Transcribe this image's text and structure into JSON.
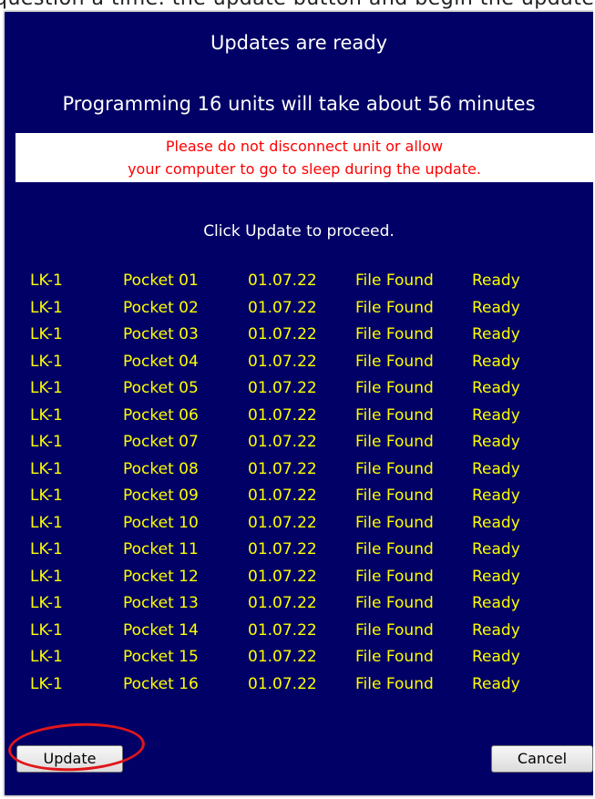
{
  "top_caption": "question a time. the update button and begin the update.",
  "dialog": {
    "title": "Updates are ready",
    "subtitle": "Programming 16 units will take about 56 minutes",
    "warning_line1": "Please do not disconnect unit or allow",
    "warning_line2": "your computer to go to sleep during the update.",
    "instruction": "Click Update to proceed.",
    "units": [
      {
        "model": "LK-1",
        "pocket": "Pocket 01",
        "version": "01.07.22",
        "file": "File Found",
        "status": "Ready"
      },
      {
        "model": "LK-1",
        "pocket": "Pocket 02",
        "version": "01.07.22",
        "file": "File Found",
        "status": "Ready"
      },
      {
        "model": "LK-1",
        "pocket": "Pocket 03",
        "version": "01.07.22",
        "file": "File Found",
        "status": "Ready"
      },
      {
        "model": "LK-1",
        "pocket": "Pocket 04",
        "version": "01.07.22",
        "file": "File Found",
        "status": "Ready"
      },
      {
        "model": "LK-1",
        "pocket": "Pocket 05",
        "version": "01.07.22",
        "file": "File Found",
        "status": "Ready"
      },
      {
        "model": "LK-1",
        "pocket": "Pocket 06",
        "version": "01.07.22",
        "file": "File Found",
        "status": "Ready"
      },
      {
        "model": "LK-1",
        "pocket": "Pocket 07",
        "version": "01.07.22",
        "file": "File Found",
        "status": "Ready"
      },
      {
        "model": "LK-1",
        "pocket": "Pocket 08",
        "version": "01.07.22",
        "file": "File Found",
        "status": "Ready"
      },
      {
        "model": "LK-1",
        "pocket": "Pocket 09",
        "version": "01.07.22",
        "file": "File Found",
        "status": "Ready"
      },
      {
        "model": "LK-1",
        "pocket": "Pocket 10",
        "version": "01.07.22",
        "file": "File Found",
        "status": "Ready"
      },
      {
        "model": "LK-1",
        "pocket": "Pocket 11",
        "version": "01.07.22",
        "file": "File Found",
        "status": "Ready"
      },
      {
        "model": "LK-1",
        "pocket": "Pocket 12",
        "version": "01.07.22",
        "file": "File Found",
        "status": "Ready"
      },
      {
        "model": "LK-1",
        "pocket": "Pocket 13",
        "version": "01.07.22",
        "file": "File Found",
        "status": "Ready"
      },
      {
        "model": "LK-1",
        "pocket": "Pocket 14",
        "version": "01.07.22",
        "file": "File Found",
        "status": "Ready"
      },
      {
        "model": "LK-1",
        "pocket": "Pocket 15",
        "version": "01.07.22",
        "file": "File Found",
        "status": "Ready"
      },
      {
        "model": "LK-1",
        "pocket": "Pocket 16",
        "version": "01.07.22",
        "file": "File Found",
        "status": "Ready"
      }
    ],
    "update_label": "Update",
    "cancel_label": "Cancel"
  },
  "colors": {
    "dialog_background": "#000066",
    "unit_text": "#ffff00",
    "warning_text": "#ff0000",
    "highlight": "#e0161b"
  }
}
